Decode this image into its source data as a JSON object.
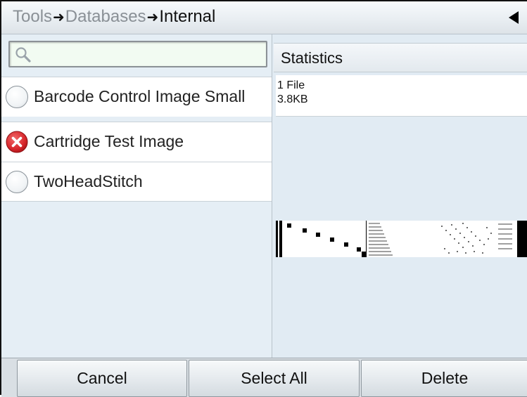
{
  "breadcrumb": {
    "items": [
      "Tools",
      "Databases",
      "Internal"
    ],
    "separator": "➜"
  },
  "search": {
    "value": "",
    "placeholder": ""
  },
  "list": {
    "items": [
      {
        "label": "Barcode Control Image Small",
        "state": "unselected"
      },
      {
        "label": "Cartridge Test Image",
        "state": "error"
      },
      {
        "label": "TwoHeadStitch",
        "state": "unselected"
      }
    ]
  },
  "stats": {
    "title": "Statistics",
    "files": "1 File",
    "size": "3.8KB"
  },
  "footer": {
    "cancel": "Cancel",
    "select_all": "Select All",
    "delete": "Delete"
  },
  "colors": {
    "background": "#e1ebf3",
    "error_red": "#d8262b",
    "search_field": "#f2fbf2"
  },
  "icons": [
    "search-icon",
    "back-arrow-icon",
    "radio-icon",
    "error-x-icon"
  ]
}
